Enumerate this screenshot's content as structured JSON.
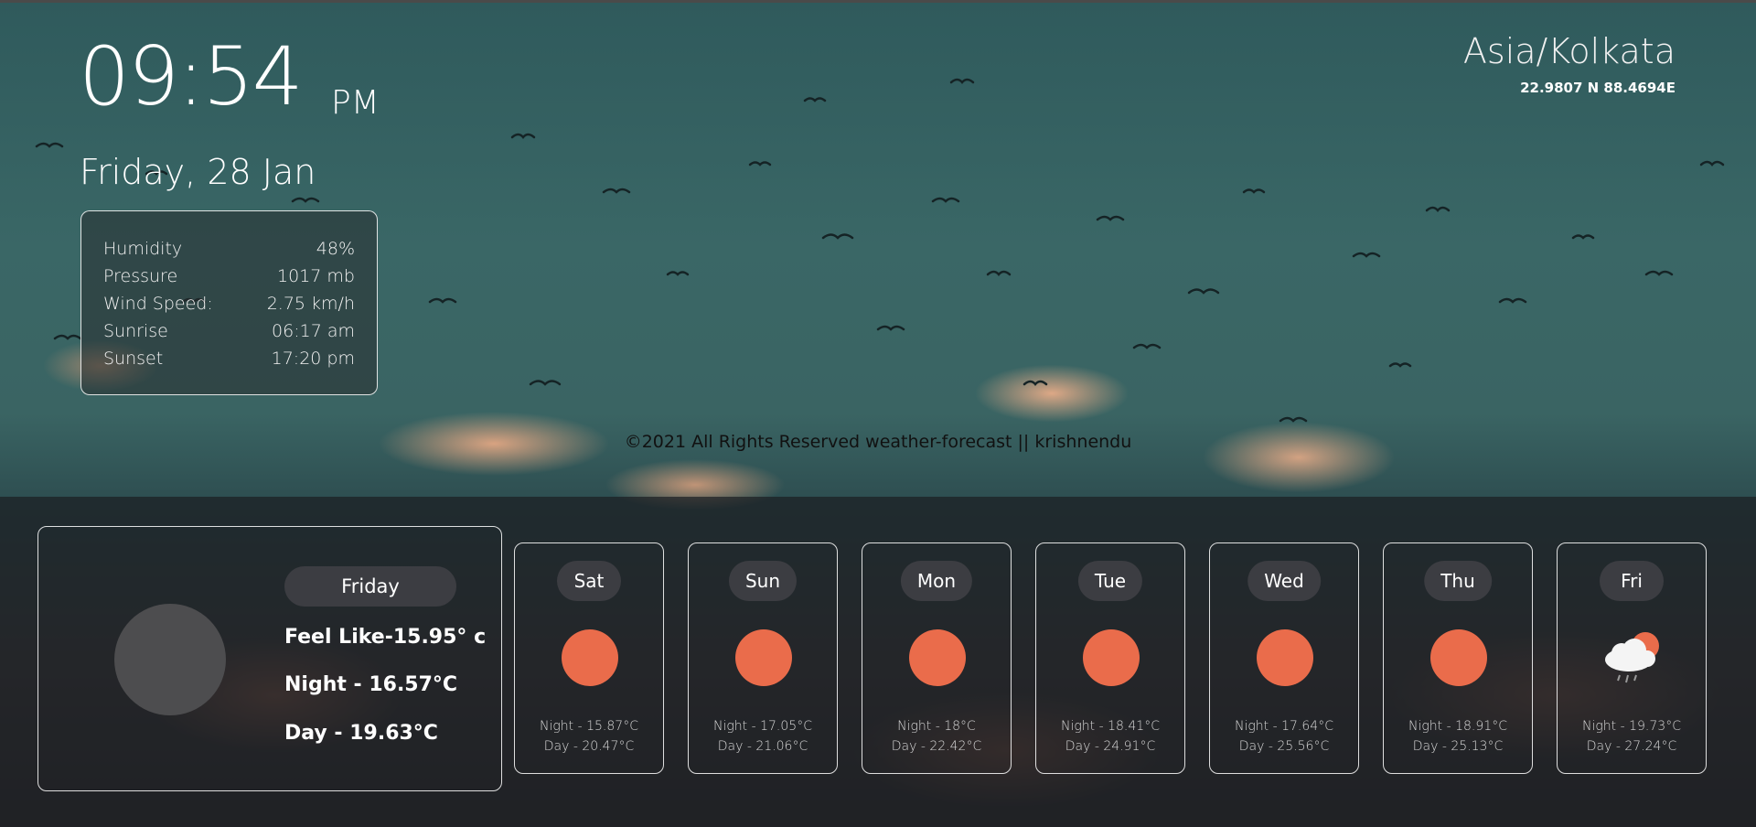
{
  "clock": {
    "time": "09:54",
    "ampm": "PM",
    "date": "Friday, 28 Jan"
  },
  "location": {
    "timezone": "Asia/Kolkata",
    "coords": "22.9807 N 88.4694E"
  },
  "details": [
    {
      "label": "Humidity",
      "value": "48%"
    },
    {
      "label": "Pressure",
      "value": "1017 mb"
    },
    {
      "label": "Wind Speed:",
      "value": "2.75 km/h"
    },
    {
      "label": "Sunrise",
      "value": "06:17 am"
    },
    {
      "label": "Sunset",
      "value": "17:20 pm"
    }
  ],
  "footer": "©2021 All Rights Reserved weather-forecast || krishnendu",
  "today": {
    "day": "Friday",
    "feels_like": "Feel Like-15.95° c",
    "night": "Night - 16.57°C",
    "day_temp": "Day - 19.63°C"
  },
  "forecast": [
    {
      "day": "Sat",
      "icon": "sun-icon",
      "night": "Night - 15.87°C",
      "day_temp": "Day - 20.47°C"
    },
    {
      "day": "Sun",
      "icon": "sun-icon",
      "night": "Night - 17.05°C",
      "day_temp": "Day - 21.06°C"
    },
    {
      "day": "Mon",
      "icon": "sun-icon",
      "night": "Night - 18°C",
      "day_temp": "Day - 22.42°C"
    },
    {
      "day": "Tue",
      "icon": "sun-icon",
      "night": "Night - 18.41°C",
      "day_temp": "Day - 24.91°C"
    },
    {
      "day": "Wed",
      "icon": "sun-icon",
      "night": "Night - 17.64°C",
      "day_temp": "Day - 25.56°C"
    },
    {
      "day": "Thu",
      "icon": "sun-icon",
      "night": "Night - 18.91°C",
      "day_temp": "Day - 25.13°C"
    },
    {
      "day": "Fri",
      "icon": "rain-cloud-icon",
      "night": "Night - 19.73°C",
      "day_temp": "Day - 27.24°C"
    }
  ],
  "colors": {
    "sun": "#ea6c4b",
    "pill": "#3c3d42",
    "panel": "#1c1e22"
  }
}
